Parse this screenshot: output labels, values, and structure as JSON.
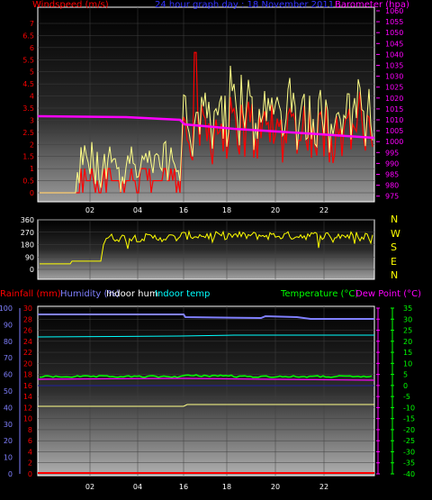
{
  "header": {
    "left_label": "Windspeed (m/s)",
    "title": "24 hour graph day : 18 November 2011",
    "right_label": "Barometer (hpa)"
  },
  "wind_y_ticks": [
    "7",
    "6.5",
    "6",
    "5.5",
    "5",
    "4.5",
    "4",
    "3.5",
    "3",
    "2.5",
    "2",
    "1.5",
    "1",
    "0.5",
    "0"
  ],
  "baro_y_ticks": [
    "1060",
    "1055",
    "1050",
    "1045",
    "1040",
    "1035",
    "1030",
    "1025",
    "1020",
    "1015",
    "1010",
    "1005",
    "1000",
    "995",
    "990",
    "985",
    "980",
    "975"
  ],
  "x_ticks": [
    "02",
    "04",
    "16",
    "18",
    "20",
    "22"
  ],
  "direction": {
    "y_ticks": [
      "360",
      "270",
      "180",
      "90",
      "0"
    ],
    "compass": [
      "N",
      "W",
      "S",
      "E",
      "N"
    ]
  },
  "bottom_header": {
    "rainfall": "Rainfall (mm)",
    "humidity": "Humidity (%)",
    "indoor_hum": "Indoor hum",
    "indoor_temp": "Indoor temp",
    "temperature": "Temperature (°C)",
    "dew_point": "Dew Point (°C)"
  },
  "humidity_ticks": [
    "100",
    "90",
    "80",
    "70",
    "60",
    "50",
    "40",
    "30",
    "20",
    "10",
    "0"
  ],
  "rain_ticks": [
    "30",
    "28",
    "26",
    "24",
    "22",
    "20",
    "18",
    "16",
    "14",
    "12",
    "10",
    "8",
    "6",
    "4",
    "2",
    "0"
  ],
  "temp_ticks_right": [
    "35",
    "30",
    "25",
    "20",
    "15",
    "10",
    "5",
    "0",
    "-5",
    "-10",
    "-15",
    "-20",
    "-25",
    "-30",
    "-35",
    "-40"
  ],
  "colors": {
    "wind": "#ff0000",
    "gust": "#ffff88",
    "barometer": "#ff00ff",
    "direction": "#ffff00",
    "rain": "#ff0000",
    "humidity": "#8080ff",
    "indoor_hum": "#ffff88",
    "indoor_temp": "#00ffff",
    "temperature": "#00ff00",
    "dew_point": "#ff00ff"
  }
}
